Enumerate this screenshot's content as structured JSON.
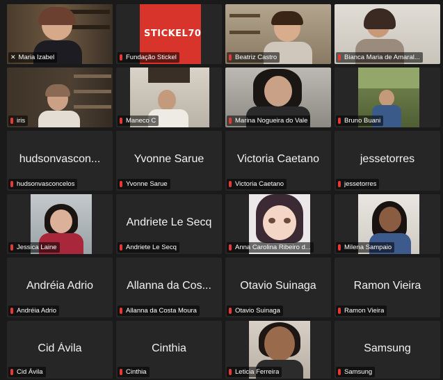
{
  "colors": {
    "background": "#1a1a1a",
    "tile": "#262626",
    "active_border": "#3ac13a",
    "muted_mic": "#e53935"
  },
  "participants": [
    {
      "label": "Maria Izabel",
      "pinned": true
    },
    {
      "label": "Fundação Stickel",
      "logo": "STICKEL70"
    },
    {
      "label": "Beatriz Castro"
    },
    {
      "label": "Bianca Maria de Amaral..."
    },
    {
      "label": "iris"
    },
    {
      "label": "Maneco C"
    },
    {
      "label": "Marina Nogueira do Vale"
    },
    {
      "label": "Bruno Buani"
    },
    {
      "label": "hudsonvasconcelos",
      "display": "hudsonvascon..."
    },
    {
      "label": "Yvonne Sarue",
      "display": "Yvonne Sarue"
    },
    {
      "label": "Victoria Caetano",
      "display": "Victoria Caetano"
    },
    {
      "label": "jessetorres",
      "display": "jessetorres"
    },
    {
      "label": "Jessica Laine"
    },
    {
      "label": "Andriete Le Secq",
      "display": "Andriete Le Secq"
    },
    {
      "label": "Anna Carolina Ribeiro d..."
    },
    {
      "label": "Milena Sampaio"
    },
    {
      "label": "Andréia Adrio",
      "display": "Andréia Adrio"
    },
    {
      "label": "Allanna da Costa Moura",
      "display": "Allanna da Cos..."
    },
    {
      "label": "Otavio Suinaga",
      "display": "Otavio Suinaga"
    },
    {
      "label": "Ramon Vieira",
      "display": "Ramon Vieira"
    },
    {
      "label": "Cid Ávila",
      "display": "Cid Ávila"
    },
    {
      "label": "Cinthia",
      "display": "Cinthia"
    },
    {
      "label": "Leticia Ferreira"
    },
    {
      "label": "Samsung",
      "display": "Samsung"
    }
  ]
}
